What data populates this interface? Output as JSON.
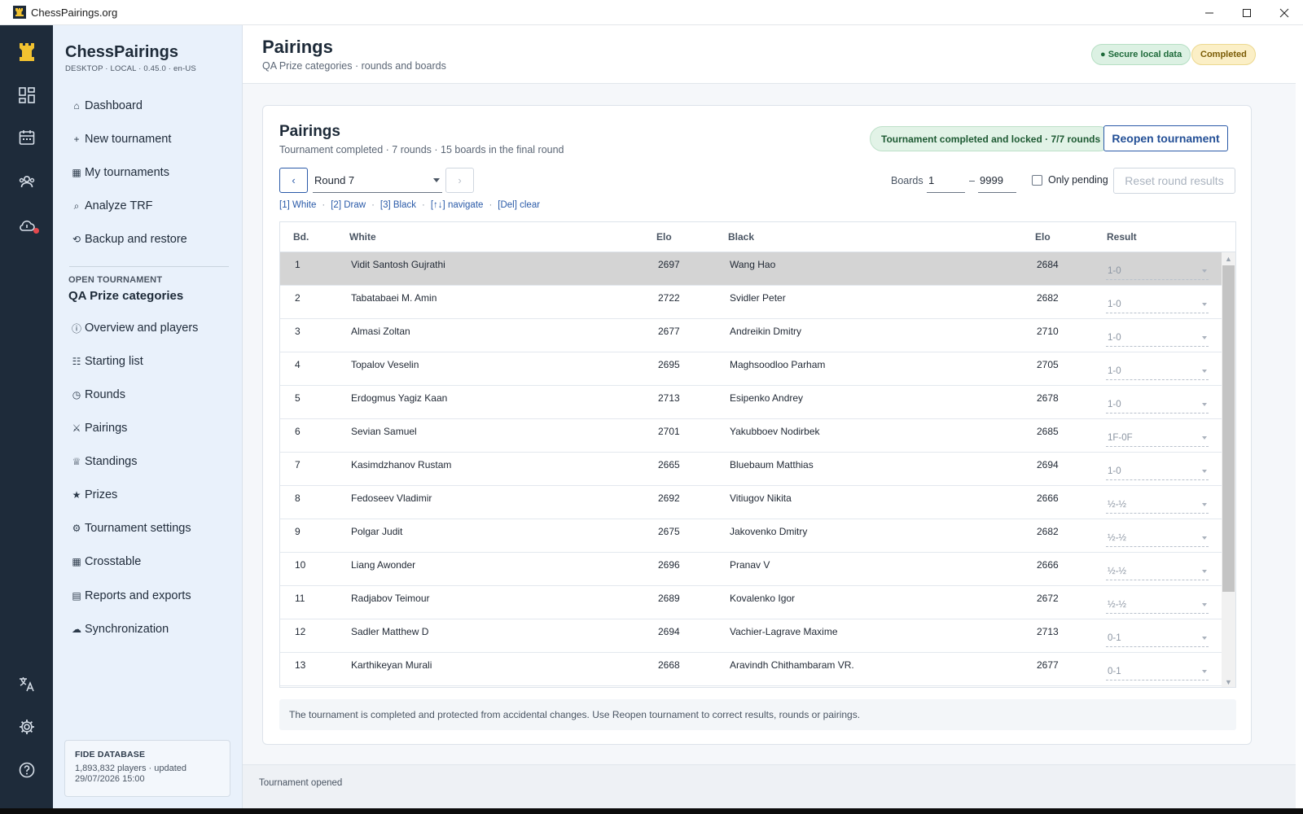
{
  "window": {
    "title": "ChessPairings.org"
  },
  "brand": {
    "name": "ChessPairings",
    "sub": "DESKTOP · LOCAL · 0.45.0 · en-US"
  },
  "sidebar": {
    "items": [
      {
        "icon": "home-icon",
        "glyph": "⌂",
        "label": "Dashboard"
      },
      {
        "icon": "plus-icon",
        "glyph": "+",
        "label": "New tournament"
      },
      {
        "icon": "grid-icon",
        "glyph": "▦",
        "label": "My tournaments"
      },
      {
        "icon": "search-icon",
        "glyph": "⌕",
        "label": "Analyze TRF"
      },
      {
        "icon": "restore-icon",
        "glyph": "⟲",
        "label": "Backup and restore"
      }
    ],
    "open_tournament_label": "OPEN TOURNAMENT",
    "open_tournament_name": "QA Prize categories",
    "tournament_items": [
      {
        "icon": "info-icon",
        "glyph": "ⓘ",
        "label": "Overview and players"
      },
      {
        "icon": "list-icon",
        "glyph": "☷",
        "label": "Starting list"
      },
      {
        "icon": "clock-icon",
        "glyph": "◷",
        "label": "Rounds"
      },
      {
        "icon": "swords-icon",
        "glyph": "⚔",
        "label": "Pairings"
      },
      {
        "icon": "crown-icon",
        "glyph": "♕",
        "label": "Standings"
      },
      {
        "icon": "star-icon",
        "glyph": "★",
        "label": "Prizes"
      },
      {
        "icon": "gear-icon",
        "glyph": "⚙",
        "label": "Tournament settings"
      },
      {
        "icon": "table-icon",
        "glyph": "▦",
        "label": "Crosstable"
      },
      {
        "icon": "report-icon",
        "glyph": "▤",
        "label": "Reports and exports"
      },
      {
        "icon": "cloud-icon",
        "glyph": "☁",
        "label": "Synchronization"
      }
    ],
    "fide": {
      "title": "FIDE DATABASE",
      "info": "1,893,832 players · updated 29/07/2026 15:00"
    }
  },
  "header": {
    "title": "Pairings",
    "subtitle": "QA Prize categories · rounds and boards",
    "badge_secure": "● Secure local data",
    "badge_status": "Completed"
  },
  "card": {
    "title": "Pairings",
    "subtitle": "Tournament completed · 7 rounds · 15 boards in the final round",
    "locked_pill": "Tournament completed and locked · 7/7 rounds",
    "reopen_label": "Reopen tournament",
    "prev_label": "‹",
    "next_label": "›",
    "round_value": "Round 7",
    "boards_label": "Boards",
    "boards_from": "1",
    "boards_dash": "–",
    "boards_to": "9999",
    "only_pending_label": "Only pending",
    "reset_label": "Reset round results",
    "shortcuts": [
      "[1] White",
      "[2] Draw",
      "[3] Black",
      "[↑↓] navigate",
      "[Del] clear"
    ],
    "shortcut_sep": "·",
    "notice": "The tournament is completed and protected from accidental changes. Use Reopen tournament to correct results, rounds or pairings."
  },
  "table": {
    "headers": {
      "board": "Bd.",
      "white": "White",
      "welo": "Elo",
      "black": "Black",
      "belo": "Elo",
      "result": "Result"
    },
    "rows": [
      {
        "bd": "1",
        "white": "Vidit Santosh Gujrathi",
        "welo": "2697",
        "black": "Wang Hao",
        "belo": "2684",
        "result": "1-0"
      },
      {
        "bd": "2",
        "white": "Tabatabaei M. Amin",
        "welo": "2722",
        "black": "Svidler Peter",
        "belo": "2682",
        "result": "1-0"
      },
      {
        "bd": "3",
        "white": "Almasi Zoltan",
        "welo": "2677",
        "black": "Andreikin Dmitry",
        "belo": "2710",
        "result": "1-0"
      },
      {
        "bd": "4",
        "white": "Topalov Veselin",
        "welo": "2695",
        "black": "Maghsoodloo Parham",
        "belo": "2705",
        "result": "1-0"
      },
      {
        "bd": "5",
        "white": "Erdogmus Yagiz Kaan",
        "welo": "2713",
        "black": "Esipenko Andrey",
        "belo": "2678",
        "result": "1-0"
      },
      {
        "bd": "6",
        "white": "Sevian Samuel",
        "welo": "2701",
        "black": "Yakubboev Nodirbek",
        "belo": "2685",
        "result": "1F-0F"
      },
      {
        "bd": "7",
        "white": "Kasimdzhanov Rustam",
        "welo": "2665",
        "black": "Bluebaum Matthias",
        "belo": "2694",
        "result": "1-0"
      },
      {
        "bd": "8",
        "white": "Fedoseev Vladimir",
        "welo": "2692",
        "black": "Vitiugov Nikita",
        "belo": "2666",
        "result": "½-½"
      },
      {
        "bd": "9",
        "white": "Polgar Judit",
        "welo": "2675",
        "black": "Jakovenko Dmitry",
        "belo": "2682",
        "result": "½-½"
      },
      {
        "bd": "10",
        "white": "Liang Awonder",
        "welo": "2696",
        "black": "Pranav V",
        "belo": "2666",
        "result": "½-½"
      },
      {
        "bd": "11",
        "white": "Radjabov Teimour",
        "welo": "2689",
        "black": "Kovalenko Igor",
        "belo": "2672",
        "result": "½-½"
      },
      {
        "bd": "12",
        "white": "Sadler Matthew D",
        "welo": "2694",
        "black": "Vachier-Lagrave Maxime",
        "belo": "2713",
        "result": "0-1"
      },
      {
        "bd": "13",
        "white": "Karthikeyan Murali",
        "welo": "2668",
        "black": "Aravindh Chithambaram VR.",
        "belo": "2677",
        "result": "0-1"
      }
    ]
  },
  "status_bar": {
    "text": "Tournament opened"
  }
}
